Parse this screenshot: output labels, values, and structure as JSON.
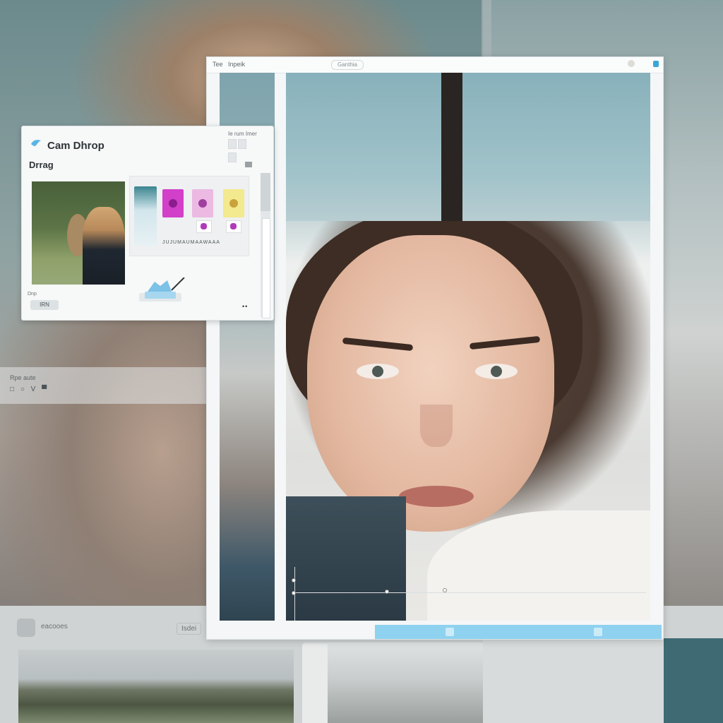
{
  "window": {
    "title_left": "Tee",
    "title_tab": "Inpeik",
    "title_field": "Ganthia"
  },
  "dialog": {
    "title": "Cam Dhrop",
    "subtitle": "Drrag",
    "header_small": "Ie rum Imer",
    "strip_text": "JUJUMAUMAAWAAA",
    "small_label": "Dnp",
    "button_label": "IRN",
    "dots": "••"
  },
  "background": {
    "strip_label": "Rpe aute",
    "strip_controls": "□ ○ V ▀",
    "bottom_label": "eacooes",
    "bottom_label2": "Isdei"
  },
  "colors": {
    "accent": "#8ed2f0",
    "close": "#3aa6d6"
  }
}
